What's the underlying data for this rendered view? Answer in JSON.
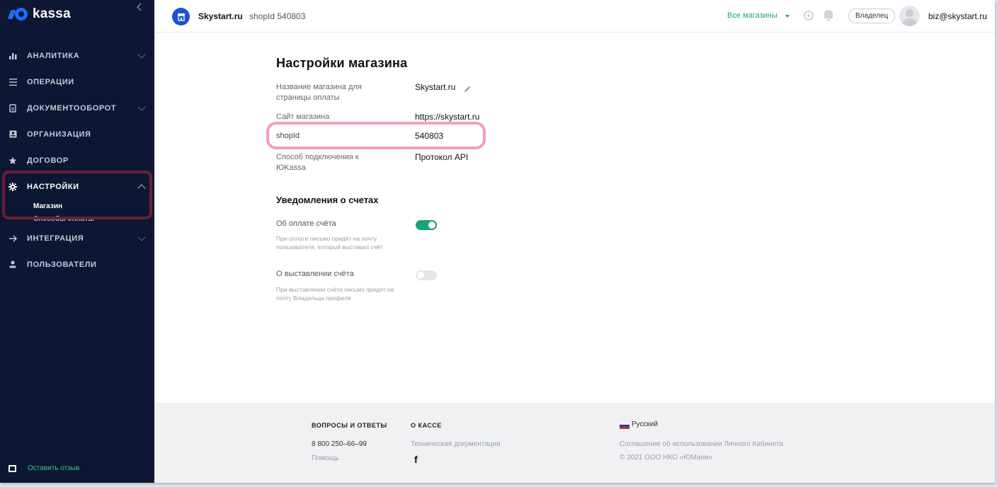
{
  "app": {
    "logo_text": "kassa",
    "brand_color": "#1b6bff"
  },
  "sidebar": {
    "items": [
      {
        "label": "АНАЛИТИКА",
        "icon": "bar-chart-icon",
        "has_chevron": true
      },
      {
        "label": "ОПЕРАЦИИ",
        "icon": "list-icon",
        "has_chevron": false
      },
      {
        "label": "ДОКУМЕНТООБОРОТ",
        "icon": "document-icon",
        "has_chevron": true
      },
      {
        "label": "ОРГАНИЗАЦИЯ",
        "icon": "id-card-icon",
        "has_chevron": false
      },
      {
        "label": "ДОГОВОР",
        "icon": "star-icon",
        "has_chevron": false
      },
      {
        "label": "НАСТРОЙКИ",
        "icon": "gear-icon",
        "has_chevron": true,
        "expanded": true
      },
      {
        "label": "ИНТЕГРАЦИЯ",
        "icon": "arrow-right-icon",
        "has_chevron": true
      },
      {
        "label": "ПОЛЬЗОВАТЕЛИ",
        "icon": "user-icon",
        "has_chevron": false
      }
    ],
    "sub_items": [
      {
        "label": "Магазин",
        "active": true
      },
      {
        "label": "Способы оплаты",
        "active": false
      }
    ],
    "feedback_label": "Оставить отзыв"
  },
  "header": {
    "shop_avatar_glyph": "🏪",
    "shop_name": "Skystart.ru",
    "shop_id": "shopId 540803",
    "all_shops": "Все магазины",
    "role": "Владелец",
    "user_email": "biz@skystart.ru"
  },
  "main": {
    "title": "Настройки магазина",
    "fields": [
      {
        "label": "Название магазина для страницы оплаты",
        "value": "Skystart.ru"
      },
      {
        "label": "Сайт магазина",
        "value": "https://skystart.ru"
      },
      {
        "label": "shopId",
        "value": "540803"
      },
      {
        "label": "Способ подключения к ЮKassa",
        "value": "Протокол API"
      }
    ],
    "notifications_title": "Уведомления о счетах",
    "notifications": [
      {
        "label": "Об оплате счёта",
        "description": "При оплате письмо придёт на почту пользователя, который выставил счёт",
        "enabled": true
      },
      {
        "label": "О выставлении счёта",
        "description": "При выставлении счёта письмо придет на почту Владельца профиля",
        "enabled": false
      }
    ],
    "accent_color": "#17a673"
  },
  "footer": {
    "faq_title": "ВОПРОСЫ И ОТВЕТЫ",
    "phone": "8 800 250–66–99",
    "help": "Помощь",
    "about_title": "О КАССЕ",
    "tech_docs": "Техническая документация",
    "facebook": "f",
    "language": "Русский",
    "agreement": "Соглашение об использовании Личного Кабинета",
    "copyright": "© 2021 ООО НКО «ЮМани»"
  }
}
